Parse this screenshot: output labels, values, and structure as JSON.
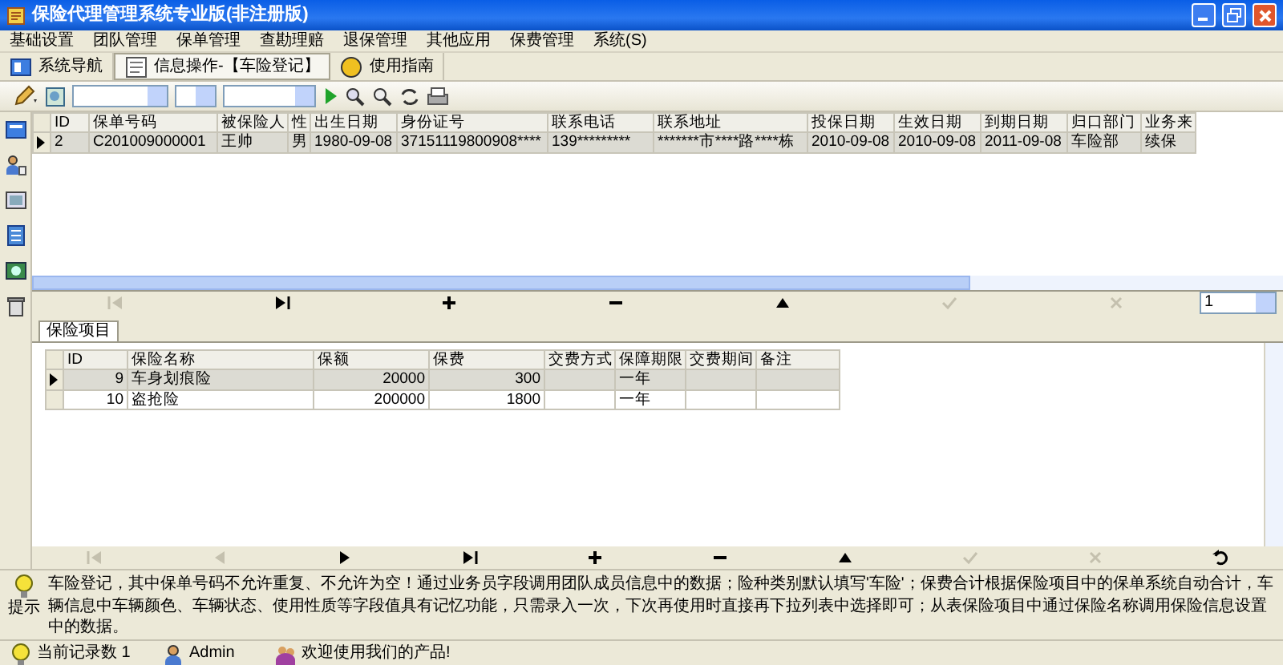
{
  "window": {
    "title": "保险代理管理系统专业版(非注册版)"
  },
  "menu": [
    {
      "label": "基础设置"
    },
    {
      "label": "团队管理"
    },
    {
      "label": "保单管理"
    },
    {
      "label": "查勘理赔"
    },
    {
      "label": "退保管理"
    },
    {
      "label": "其他应用"
    },
    {
      "label": "保费管理"
    },
    {
      "label": "系统(S)"
    }
  ],
  "tabs": [
    {
      "label": "系统导航",
      "kind": "nav",
      "selected": false
    },
    {
      "label": "信息操作-【车险登记】",
      "kind": "form",
      "selected": true
    },
    {
      "label": "使用指南",
      "kind": "help",
      "selected": false
    }
  ],
  "main_grid": {
    "columns": [
      {
        "label": "ID"
      },
      {
        "label": "保单号码"
      },
      {
        "label": "被保险人"
      },
      {
        "label": "性"
      },
      {
        "label": "出生日期"
      },
      {
        "label": "身份证号"
      },
      {
        "label": "联系电话"
      },
      {
        "label": "联系地址"
      },
      {
        "label": "投保日期"
      },
      {
        "label": "生效日期"
      },
      {
        "label": "到期日期"
      },
      {
        "label": "归口部门"
      },
      {
        "label": "业务来"
      }
    ],
    "rows": [
      {
        "selected": true,
        "cells": [
          "2",
          "C201009000001",
          "王帅",
          "男",
          "1980-09-08",
          "37151119800908****",
          "139*********",
          "*******市****路****栋",
          "2010-09-08",
          "2010-09-08",
          "2011-09-08",
          "车险部",
          "续保"
        ]
      }
    ]
  },
  "main_navigator": {
    "buttons": [
      {
        "kind": "first",
        "disabled": true
      },
      {
        "kind": "last",
        "disabled": false
      },
      {
        "kind": "insert",
        "disabled": false
      },
      {
        "kind": "delete",
        "disabled": false
      },
      {
        "kind": "edit",
        "disabled": false
      },
      {
        "kind": "post",
        "disabled": true
      },
      {
        "kind": "cancel",
        "disabled": true
      }
    ],
    "page": "1"
  },
  "detail_tabs": [
    {
      "label": "保险项目",
      "selected": true
    }
  ],
  "detail_grid": {
    "columns": [
      {
        "label": "ID"
      },
      {
        "label": "保险名称"
      },
      {
        "label": "保额"
      },
      {
        "label": "保费"
      },
      {
        "label": "交费方式"
      },
      {
        "label": "保障期限"
      },
      {
        "label": "交费期间"
      },
      {
        "label": "备注"
      }
    ],
    "rows": [
      {
        "selected": true,
        "cells": [
          "9",
          "车身划痕险",
          "20000",
          "300",
          null,
          "一年",
          null,
          null
        ]
      },
      {
        "selected": false,
        "cells": [
          "10",
          "盗抢险",
          "200000",
          "1800",
          null,
          "一年",
          null,
          null
        ]
      }
    ]
  },
  "detail_navigator": {
    "buttons": [
      {
        "kind": "first",
        "disabled": true
      },
      {
        "kind": "prior",
        "disabled": true
      },
      {
        "kind": "next",
        "disabled": false
      },
      {
        "kind": "last",
        "disabled": false
      },
      {
        "kind": "insert",
        "disabled": false
      },
      {
        "kind": "delete",
        "disabled": false
      },
      {
        "kind": "edit",
        "disabled": false
      },
      {
        "kind": "post",
        "disabled": true
      },
      {
        "kind": "cancel",
        "disabled": true
      },
      {
        "kind": "refresh",
        "disabled": false
      }
    ]
  },
  "hint": {
    "label": "提示",
    "text": "车险登记，其中保单号码不允许重复、不允许为空！通过业务员字段调用团队成员信息中的数据；险种类别默认填写'车险'；保费合计根据保险项目中的保单系统自动合计，车辆信息中车辆颜色、车辆状态、使用性质等字段值具有记忆功能，只需录入一次，下次再使用时直接再下拉列表中选择即可；从表保险项目中通过保险名称调用保险信息设置中的数据。"
  },
  "status_bar": [
    {
      "kind": "count",
      "text": "当前记录数 1"
    },
    {
      "kind": "user",
      "text": "Admin"
    },
    {
      "kind": "welcome",
      "text": "欢迎使用我们的产品!"
    }
  ]
}
